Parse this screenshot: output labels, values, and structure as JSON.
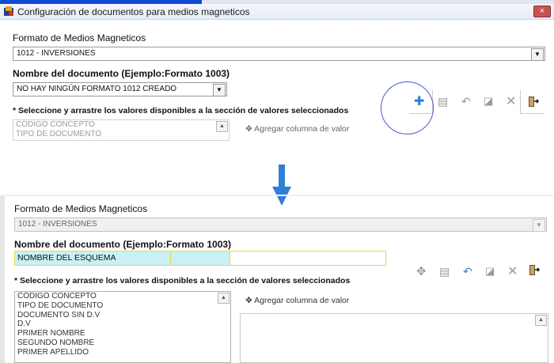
{
  "window": {
    "title": "Configuración de documentos para medios magneticos",
    "close_label": "×"
  },
  "top": {
    "formato_label": "Formato de Medios Magneticos",
    "formato_value": "1012 - INVERSIONES",
    "nombre_label": "Nombre del documento (Ejemplo:Formato 1003)",
    "nombre_value": "NO HAY NINGÚN FORMATO 1012 CREADO",
    "hint": "* Seleccione y arrastre los valores disponibles a la sección de valores seleccionados",
    "available_values": [
      "CÓDIGO CONCEPTO",
      "TIPO DE DOCUMENTO"
    ],
    "add_column_label": "Agregar columna de valor"
  },
  "bottom": {
    "formato_label": "Formato de Medios Magneticos",
    "formato_value": "1012 - INVERSIONES",
    "nombre_label": "Nombre del documento (Ejemplo:Formato 1003)",
    "nombre_value": "NOMBRE DEL ESQUEMA",
    "hint": "* Seleccione y arrastre los valores disponibles a la sección de valores seleccionados",
    "available_values": [
      "CÓDIGO CONCEPTO",
      "TIPO DE DOCUMENTO",
      "DOCUMENTO SIN D.V",
      "D.V",
      "PRIMER NOMBRE",
      "SEGUNDO NOMBRE",
      "PRIMER APELLIDO"
    ],
    "add_column_label": "Agregar columna de valor"
  },
  "icons": {
    "add": "add-icon",
    "edit": "edit-icon",
    "undo": "undo-icon",
    "save": "save-icon",
    "delete": "delete-icon",
    "exit": "exit-icon"
  },
  "colors": {
    "accent_blue": "#2f7fd6",
    "name_field_bg": "#c9f1f5",
    "name_field_border": "#e6d84a",
    "titlebar_blue": "#0d4bd6"
  }
}
